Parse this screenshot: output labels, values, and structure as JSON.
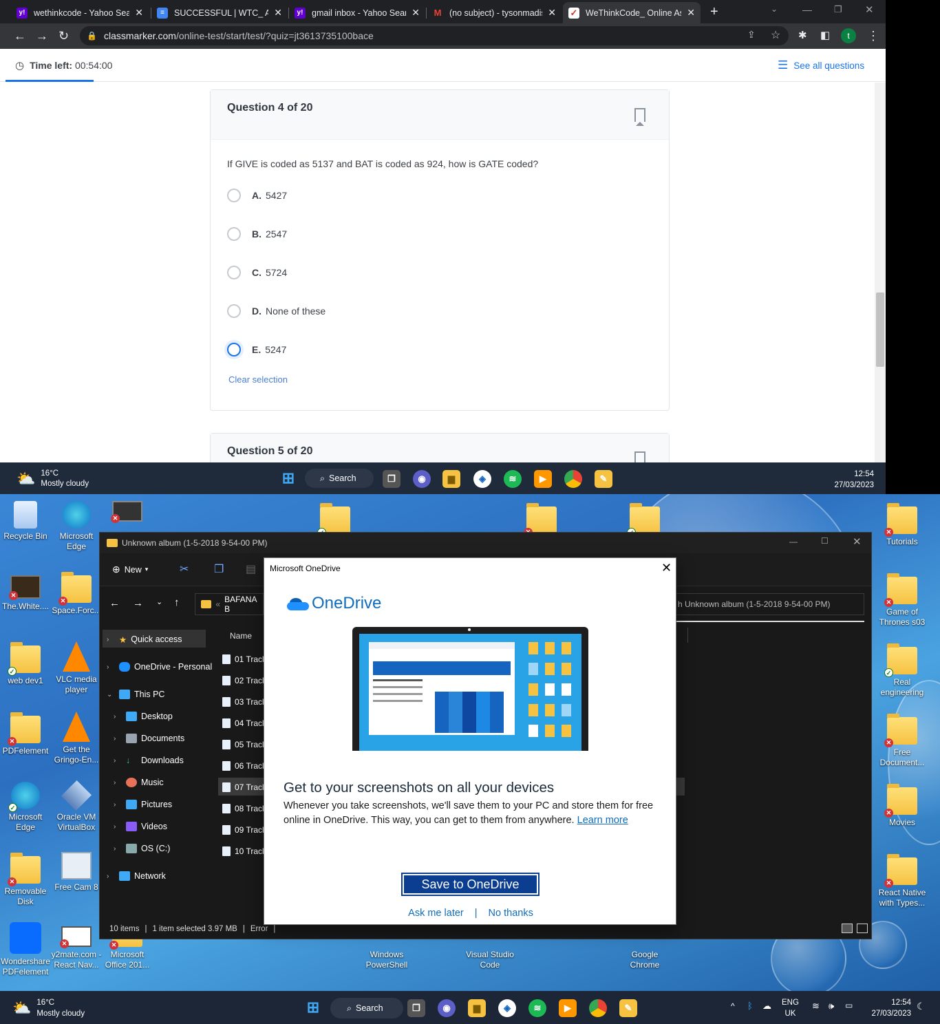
{
  "browser": {
    "tabs": [
      {
        "label": "wethinkcode - Yahoo Sear",
        "favicon": "yahoo-icon",
        "color": "#6001d2"
      },
      {
        "label": "SUCCESSFUL | WTC_ Appl",
        "favicon": "doc-icon",
        "color": "#4285f4"
      },
      {
        "label": "gmail inbox - Yahoo Searc",
        "favicon": "yahoo-icon",
        "color": "#6001d2"
      },
      {
        "label": "(no subject) - tysonmadis",
        "favicon": "gmail-icon",
        "color": "#ea4335"
      },
      {
        "label": "WeThinkCode_ Online Ass",
        "favicon": "classmarker-icon",
        "color": "#d93025"
      }
    ],
    "new_tab": "+",
    "url_domain": "classmarker.com",
    "url_path": "/online-test/start/test/?quiz=jt3613735100bace",
    "profile_initial": "t"
  },
  "quiz": {
    "time_label": "Time left:",
    "time_value": "00:54:00",
    "see_all": "See all questions",
    "progress_percent": 10,
    "question_header": "Question 4 of 20",
    "question_text": "If GIVE is coded as 5137 and BAT is coded as 924, how is GATE coded?",
    "options": [
      {
        "letter": "A.",
        "text": "5427",
        "selected": false
      },
      {
        "letter": "B.",
        "text": "2547",
        "selected": false
      },
      {
        "letter": "C.",
        "text": "5724",
        "selected": false
      },
      {
        "letter": "D.",
        "text": "None of these",
        "selected": false
      },
      {
        "letter": "E.",
        "text": "5247",
        "selected": true
      }
    ],
    "clear_selection": "Clear selection",
    "next_question_header": "Question 5 of 20"
  },
  "taskbar_top": {
    "temp": "16°C",
    "weather": "Mostly cloudy",
    "search": "Search",
    "time": "12:54",
    "date": "27/03/2023"
  },
  "desktop": {
    "left_icons": [
      {
        "label": "Recycle Bin",
        "icon": "recycle-bin-icon"
      },
      {
        "label": "Microsoft Edge",
        "icon": "edge-icon"
      },
      {
        "label": "The.White....",
        "icon": "video-icon"
      },
      {
        "label": "Space.Forc...",
        "icon": "folder-icon"
      },
      {
        "label": "web dev1",
        "icon": "folder-icon"
      },
      {
        "label": "VLC media player",
        "icon": "vlc-icon"
      },
      {
        "label": "PDFelement",
        "icon": "folder-icon"
      },
      {
        "label": "Get the Gringo-En...",
        "icon": "vlc-icon"
      },
      {
        "label": "Microsoft Edge",
        "icon": "edge-icon"
      },
      {
        "label": "Oracle VM VirtualBox",
        "icon": "virtualbox-icon"
      },
      {
        "label": "Removable Disk",
        "icon": "folder-icon"
      },
      {
        "label": "Free Cam 8",
        "icon": "freecam-icon"
      },
      {
        "label": "Wondershare PDFelement",
        "icon": "pdfelement-icon"
      },
      {
        "label": "y2mate.com - React Nav...",
        "icon": "video-icon"
      },
      {
        "label": "Microsoft Office 201...",
        "icon": "folder-icon"
      }
    ],
    "right_icons": [
      {
        "label": "Tutorials"
      },
      {
        "label": "Game of Thrones s03"
      },
      {
        "label": "Real engineering"
      },
      {
        "label": "Free Document..."
      },
      {
        "label": "Movies"
      },
      {
        "label": "React Native with Types..."
      }
    ],
    "bottom_icons": [
      {
        "label": "Windows PowerShell"
      },
      {
        "label": "Visual Studio Code"
      },
      {
        "label": "Google Chrome"
      }
    ]
  },
  "explorer": {
    "title": "Unknown album (1-5-2018 9-54-00 PM)",
    "new_label": "New",
    "breadcrumb": "BAFANA B",
    "search_placeholder": "h Unknown album (1-5-2018 9-54-00 PM)",
    "column_name": "Name",
    "nav": [
      {
        "label": "Quick access",
        "icon": "star-icon"
      },
      {
        "label": "OneDrive - Personal",
        "icon": "onedrive-icon"
      },
      {
        "label": "This PC",
        "icon": "pc-icon"
      },
      {
        "label": "Desktop",
        "icon": "desktop-icon"
      },
      {
        "label": "Documents",
        "icon": "documents-icon"
      },
      {
        "label": "Downloads",
        "icon": "downloads-icon"
      },
      {
        "label": "Music",
        "icon": "music-icon"
      },
      {
        "label": "Pictures",
        "icon": "pictures-icon"
      },
      {
        "label": "Videos",
        "icon": "videos-icon"
      },
      {
        "label": "OS (C:)",
        "icon": "drive-icon"
      },
      {
        "label": "Network",
        "icon": "network-icon"
      }
    ],
    "files": [
      "01 Track",
      "02 Track",
      "03 Track",
      "04 Track",
      "05 Track",
      "06 Track",
      "07 Track",
      "08 Track",
      "09 Track",
      "10 Track"
    ],
    "status_items": "10 items",
    "status_selected": "1 item selected  3.97 MB",
    "status_error": "Error"
  },
  "onedrive_dialog": {
    "window_title": "Microsoft OneDrive",
    "brand": "OneDrive",
    "heading": "Get to your screenshots on all your devices",
    "body": "Whenever you take screenshots, we'll save them to your PC and store them for free online in OneDrive. This way, you can get to them from anywhere.",
    "learn_more": "Learn more",
    "save_button": "Save to OneDrive",
    "ask_later": "Ask me later",
    "no_thanks": "No thanks"
  },
  "taskbar_bottom": {
    "temp": "16°C",
    "weather": "Mostly cloudy",
    "search": "Search",
    "lang": "ENG",
    "region": "UK",
    "time": "12:54",
    "date": "27/03/2023"
  }
}
